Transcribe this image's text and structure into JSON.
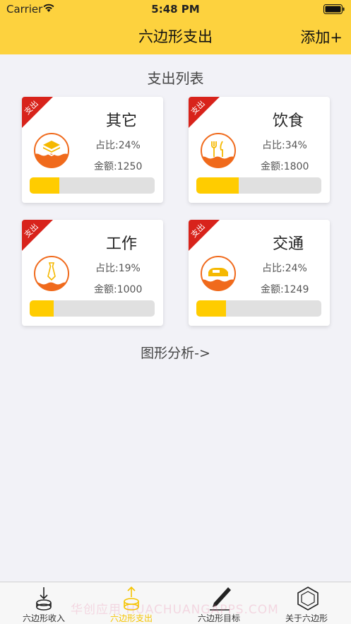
{
  "status": {
    "carrier": "Carrier",
    "time": "5:48 PM"
  },
  "nav": {
    "title": "六边形支出",
    "add_label": "添加+"
  },
  "section_title": "支出列表",
  "cards": [
    {
      "badge": "支出",
      "name": "其它",
      "ratio": "占比:24%",
      "amount": "金额:1250",
      "progress": 0.24,
      "icon": "layers-icon"
    },
    {
      "badge": "支出",
      "name": "饮食",
      "ratio": "占比:34%",
      "amount": "金额:1800",
      "progress": 0.34,
      "icon": "fork-knife-icon"
    },
    {
      "badge": "支出",
      "name": "工作",
      "ratio": "占比:19%",
      "amount": "金额:1000",
      "progress": 0.19,
      "icon": "tie-icon"
    },
    {
      "badge": "支出",
      "name": "交通",
      "ratio": "占比:24%",
      "amount": "金额:1249",
      "progress": 0.24,
      "icon": "car-icon"
    }
  ],
  "analysis_link": "图形分析->",
  "tabs": [
    {
      "label": "六边形收入",
      "icon": "coin-stack-down-icon",
      "active": false
    },
    {
      "label": "六边形支出",
      "icon": "coin-stack-up-icon",
      "active": true
    },
    {
      "label": "六边形目标",
      "icon": "pen-icon",
      "active": false
    },
    {
      "label": "关于六边形",
      "icon": "hexagon-icon",
      "active": false
    }
  ],
  "watermark": "华创应用 HUACHUANGAPPS.COM",
  "colors": {
    "accent": "#fdd23e",
    "progress": "#ffcc00",
    "ribbon": "#d8231b",
    "icon_orange": "#f06a1c"
  }
}
